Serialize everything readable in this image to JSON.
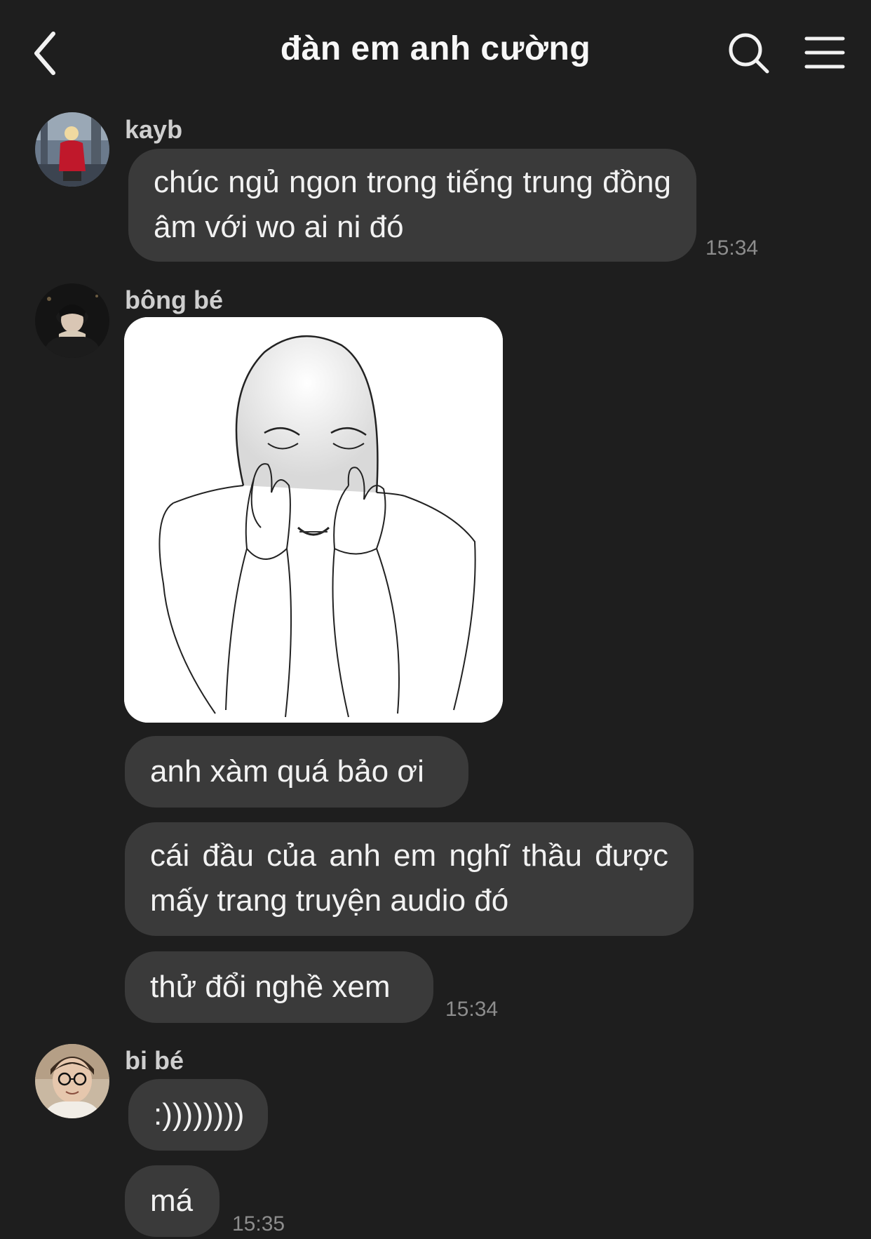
{
  "header": {
    "title": "đàn em anh cường",
    "back_icon": "chevron-left-icon",
    "search_icon": "search-icon",
    "menu_icon": "menu-icon"
  },
  "colors": {
    "background": "#1e1e1e",
    "bubble": "#3a3a3a",
    "text": "#f2f2f2",
    "timestamp": "#8d8d8d"
  },
  "messages": [
    {
      "sender": "kayb",
      "bubbles": [
        "chúc ngủ ngon trong tiếng trung đồng âm với wo ai ni đó"
      ],
      "time": "15:34"
    },
    {
      "sender": "bông bé",
      "image": "sketch-image",
      "bubbles": [
        "anh xàm quá bảo ơi",
        "cái đầu của anh em nghĩ thầu được mấy trang truyện audio đó",
        "thử đổi nghề xem"
      ],
      "time": "15:34"
    },
    {
      "sender": "bi bé",
      "bubbles": [
        ":))))))))",
        "má"
      ],
      "time": "15:35"
    }
  ]
}
